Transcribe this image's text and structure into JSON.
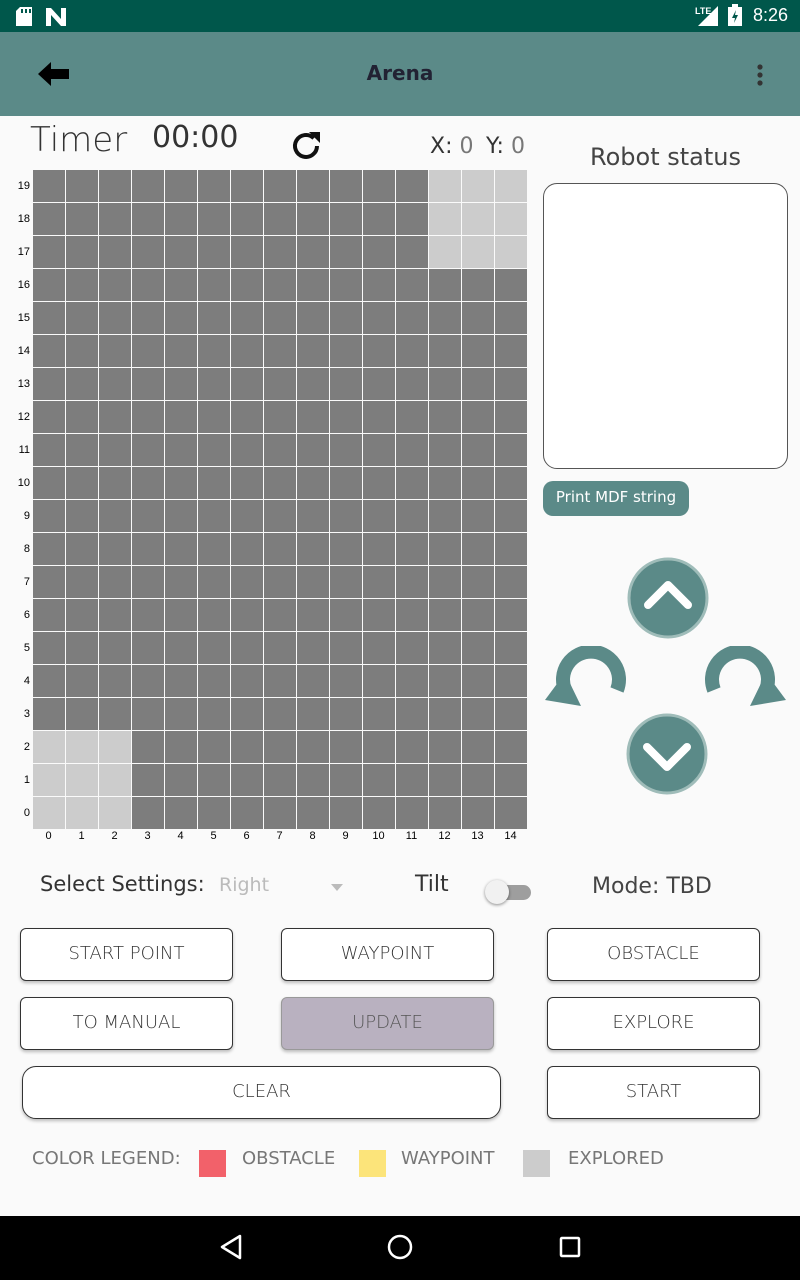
{
  "status_bar": {
    "time": "8:26",
    "network": "LTE",
    "icons": [
      "sd-card-icon",
      "n-logo-icon",
      "signal-icon",
      "battery-icon"
    ]
  },
  "app_bar": {
    "title": "Arena",
    "back_icon": "arrow-left-icon",
    "menu_icon": "more-vertical-icon"
  },
  "timer": {
    "label": "Timer",
    "value": "00:00"
  },
  "coords": {
    "x_label": "X:",
    "x_value": "0",
    "y_label": "Y:",
    "y_value": "0"
  },
  "arena": {
    "cols": 15,
    "rows": 20,
    "col_labels": [
      "0",
      "1",
      "2",
      "3",
      "4",
      "5",
      "6",
      "7",
      "8",
      "9",
      "10",
      "11",
      "12",
      "13",
      "14"
    ],
    "row_labels": [
      "19",
      "18",
      "17",
      "16",
      "15",
      "14",
      "13",
      "12",
      "11",
      "10",
      "9",
      "8",
      "7",
      "6",
      "5",
      "4",
      "3",
      "2",
      "1",
      "0"
    ],
    "explored_cells": [
      [
        12,
        19
      ],
      [
        13,
        19
      ],
      [
        14,
        19
      ],
      [
        12,
        18
      ],
      [
        13,
        18
      ],
      [
        14,
        18
      ],
      [
        12,
        17
      ],
      [
        13,
        17
      ],
      [
        14,
        17
      ],
      [
        0,
        2
      ],
      [
        1,
        2
      ],
      [
        2,
        2
      ],
      [
        0,
        1
      ],
      [
        1,
        1
      ],
      [
        2,
        1
      ],
      [
        0,
        0
      ],
      [
        1,
        0
      ],
      [
        2,
        0
      ]
    ],
    "colors": {
      "unexplored": "#7d7d7d",
      "explored": "#cccccc",
      "grid_line": "#ffffff"
    }
  },
  "robot_status": {
    "label": "Robot status",
    "content": ""
  },
  "mdf_button": {
    "label": "Print MDF string"
  },
  "controls": {
    "icons": [
      "chevron-up-icon",
      "rotate-left-icon",
      "rotate-right-icon",
      "chevron-down-icon"
    ],
    "color": "#5b8a88"
  },
  "settings": {
    "label": "Select Settings:",
    "selected": "Right",
    "tilt_label": "Tilt",
    "tilt_on": false,
    "mode_label": "Mode: TBD"
  },
  "buttons": {
    "start_point": "START POINT",
    "waypoint": "WAYPOINT",
    "obstacle": "OBSTACLE",
    "to_manual": "TO MANUAL",
    "update": "UPDATE",
    "explore": "EXPLORE",
    "clear": "CLEAR",
    "start": "START"
  },
  "legend": {
    "title": "COLOR LEGEND:",
    "items": [
      {
        "label": "OBSTACLE",
        "color": "#f2616a"
      },
      {
        "label": "WAYPOINT",
        "color": "#fce47a"
      },
      {
        "label": "EXPLORED",
        "color": "#cccccc"
      }
    ]
  },
  "nav_bar": {
    "icons": [
      "back-triangle-icon",
      "home-circle-icon",
      "recents-square-icon"
    ]
  }
}
